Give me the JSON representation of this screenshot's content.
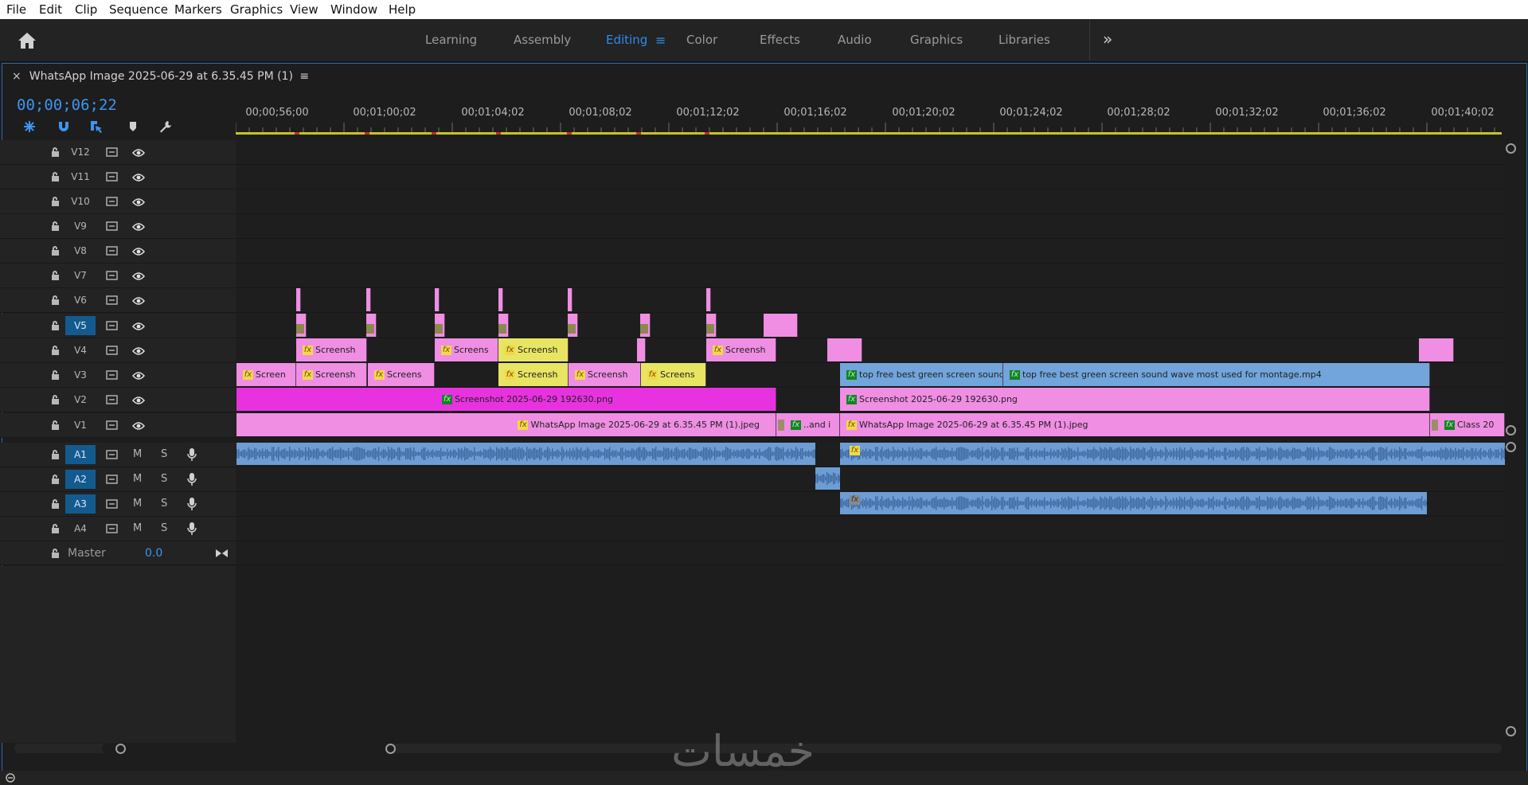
{
  "menu": {
    "items": [
      "File",
      "Edit",
      "Clip",
      "Sequence",
      "Markers",
      "Graphics",
      "View",
      "Window",
      "Help"
    ]
  },
  "workspace": {
    "tabs": [
      "Learning",
      "Assembly",
      "Editing",
      "Color",
      "Effects",
      "Audio",
      "Graphics",
      "Libraries"
    ],
    "active": "Editing",
    "active_glyph": "≡",
    "more_glyph": "»"
  },
  "sequence": {
    "close_glyph": "×",
    "title": "WhatsApp Image 2025-06-29 at 6.35.45 PM (1)",
    "menu_glyph": "≡",
    "timecode": "00;00;06;22"
  },
  "ruler": {
    "labels": [
      "00;00;56;00",
      "00;01;00;02",
      "00;01;04;02",
      "00;01;08;02",
      "00;01;12;02",
      "00;01;16;02",
      "00;01;20;02",
      "00;01;24;02",
      "00;01;28;02",
      "00;01;32;02",
      "00;01;36;02",
      "00;01;40;02"
    ]
  },
  "video_tracks": [
    "V12",
    "V11",
    "V10",
    "V9",
    "V8",
    "V7",
    "V6",
    "V5",
    "V4",
    "V3",
    "V2",
    "V1"
  ],
  "selected_video_track": "V5",
  "audio_tracks": [
    "A1",
    "A2",
    "A3",
    "A4"
  ],
  "selected_audio_track": "A1",
  "audio_buttons": {
    "mute": "M",
    "solo": "S"
  },
  "master": {
    "label": "Master",
    "value": "0.0"
  },
  "clips": {
    "v4": [
      {
        "label": "Screensh"
      },
      {
        "label": "Screens"
      },
      {
        "label": "Screensh"
      },
      {
        "label": "Screensh"
      }
    ],
    "v3": [
      {
        "label": "Screen"
      },
      {
        "label": "Screensh"
      },
      {
        "label": "Screens"
      },
      {
        "label": "Screensh"
      },
      {
        "label": "Screensh"
      },
      {
        "label": "Screens"
      },
      {
        "label": "top free best green screen sound"
      },
      {
        "label": "top free best green screen sound wave most used for montage.mp4"
      }
    ],
    "v2": [
      {
        "label": "Screenshot 2025-06-29 192630.png"
      },
      {
        "label": "Screenshot 2025-06-29 192630.png"
      }
    ],
    "v1": [
      {
        "label": "WhatsApp Image 2025-06-29 at 6.35.45 PM (1).jpeg"
      },
      {
        "label": "..and i"
      },
      {
        "label": "WhatsApp Image 2025-06-29 at 6.35.45 PM (1).jpeg"
      },
      {
        "label": "Class 20"
      }
    ]
  },
  "fx_glyph": "fx",
  "watermark": "خمسات",
  "colors": {
    "accent": "#2d8ceb",
    "clip_pink": "#ef8ee3",
    "clip_magenta": "#e832e0",
    "clip_yellow": "#e8e563",
    "clip_blue": "#71a5db",
    "audio_blue": "#6d9dd4"
  }
}
